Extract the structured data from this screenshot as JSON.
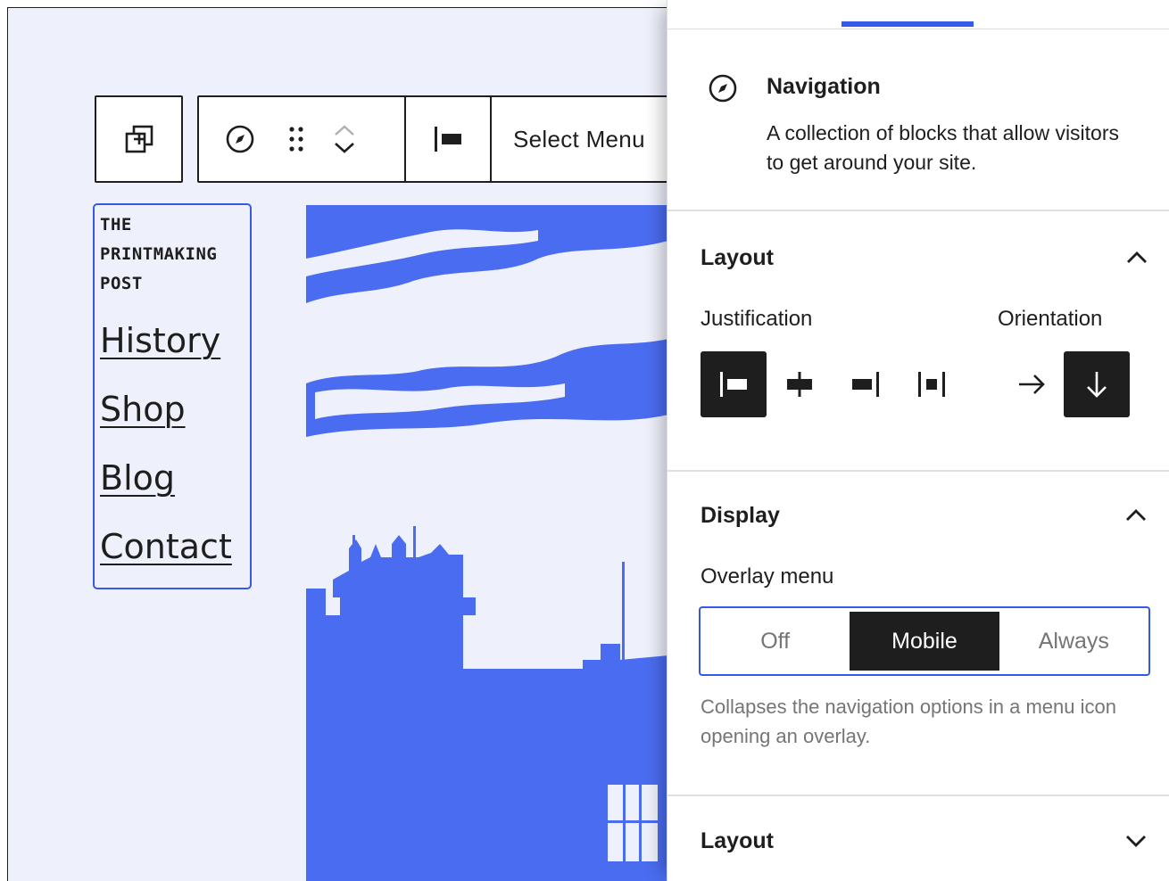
{
  "toolbar": {
    "parent_icon": "select-parent-icon",
    "block_icon": "compass-icon",
    "drag_icon": "drag-handle-icon",
    "move_up_icon": "chevron-up-icon",
    "move_down_icon": "chevron-down-icon",
    "justify_icon": "justify-left-icon",
    "select_menu_label": "Select Menu"
  },
  "canvas": {
    "site_title_lines": [
      "THE",
      "PRINTMAKING",
      "POST"
    ],
    "nav_links": [
      "History",
      "Shop",
      "Blog",
      "Contact"
    ],
    "artwork_color": "#4a6cf0"
  },
  "sidebar": {
    "block_card": {
      "icon": "compass-icon",
      "title": "Navigation",
      "description": "A collection of blocks that allow visitors to get around your site."
    },
    "layout_panel": {
      "title": "Layout",
      "expanded": true,
      "justification_label": "Justification",
      "orientation_label": "Orientation",
      "justification_options": [
        "justify-left-icon",
        "justify-center-icon",
        "justify-right-icon",
        "justify-space-between-icon"
      ],
      "justification_selected": "justify-left-icon",
      "orientation_options": [
        "arrow-right-icon",
        "arrow-down-icon"
      ],
      "orientation_selected": "arrow-down-icon"
    },
    "display_panel": {
      "title": "Display",
      "expanded": true,
      "overlay_label": "Overlay menu",
      "overlay_options": [
        "Off",
        "Mobile",
        "Always"
      ],
      "overlay_selected": "Mobile",
      "help_text": "Collapses the navigation options in a menu icon opening an overlay."
    },
    "layout_panel_2": {
      "title": "Layout",
      "expanded": false
    }
  },
  "colors": {
    "accent": "#3858e9",
    "dark": "#1e1e1e",
    "canvas_bg": "#eef0fb",
    "muted": "#757575"
  }
}
